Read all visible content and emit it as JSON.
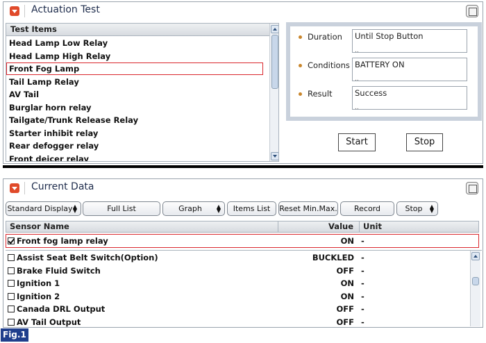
{
  "actuation": {
    "title": "Actuation Test",
    "list_header": "Test Items",
    "items": [
      "Head Lamp Low Relay",
      "Head Lamp High Relay",
      "Front Fog Lamp",
      "Tail Lamp Relay",
      "AV Tail",
      "Burglar horn relay",
      "Tailgate/Trunk Release Relay",
      "Starter inhibit relay",
      "Rear defogger relay",
      "Front deicer relay"
    ],
    "selected_index": 2,
    "fields": [
      {
        "label": "Duration",
        "value": "Until Stop Button"
      },
      {
        "label": "Conditions",
        "value": "BATTERY ON"
      },
      {
        "label": "Result",
        "value": "Success"
      }
    ],
    "start_label": "Start",
    "stop_label": "Stop"
  },
  "current_data": {
    "title": "Current Data",
    "toolbar": [
      "Standard Display",
      "Full List",
      "Graph",
      "Items List",
      "Reset Min.Max.",
      "Record",
      "Stop"
    ],
    "columns": {
      "name": "Sensor Name",
      "value": "Value",
      "unit": "Unit"
    },
    "pinned_row": {
      "name": "Front fog lamp relay",
      "value": "ON",
      "unit": "-",
      "checked": true
    },
    "rows": [
      {
        "name": "Assist Seat Belt Switch(Option)",
        "value": "BUCKLED",
        "unit": "-"
      },
      {
        "name": "Brake Fluid Switch",
        "value": "OFF",
        "unit": "-"
      },
      {
        "name": "Ignition 1",
        "value": "ON",
        "unit": "-"
      },
      {
        "name": "Ignition 2",
        "value": "ON",
        "unit": "-"
      },
      {
        "name": "Canada DRL Output",
        "value": "OFF",
        "unit": "-"
      },
      {
        "name": "AV Tail Output",
        "value": "OFF",
        "unit": "-"
      }
    ]
  },
  "figure_label": "Fig.1",
  "colors": {
    "accent_red": "#e04a2a",
    "selection_outline": "#d9262c",
    "fig_badge": "#1f3e8c"
  }
}
